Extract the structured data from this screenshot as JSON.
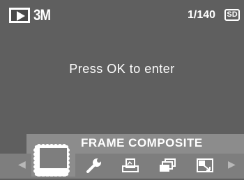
{
  "status_bar": {
    "mode_icon": "play-icon",
    "image_size": "3M",
    "frame_counter": "1/140",
    "card_badge": "SD"
  },
  "message": "Press OK to enter",
  "menu": {
    "selected_label": "FRAME COMPOSITE",
    "items": [
      {
        "name": "frame-composite",
        "icon": "frame-icon",
        "selected": true
      },
      {
        "name": "settings",
        "icon": "wrench-icon"
      },
      {
        "name": "print",
        "icon": "print-icon"
      },
      {
        "name": "slideshow",
        "icon": "stack-icon"
      },
      {
        "name": "resize",
        "icon": "resize-icon"
      }
    ],
    "left_arrow": "◀",
    "right_arrow": "▶"
  },
  "colors": {
    "background": "#5f5f5f",
    "label_band": "#8c8c8c",
    "icon_band": "#7e7e7e",
    "foreground": "#ffffff"
  }
}
